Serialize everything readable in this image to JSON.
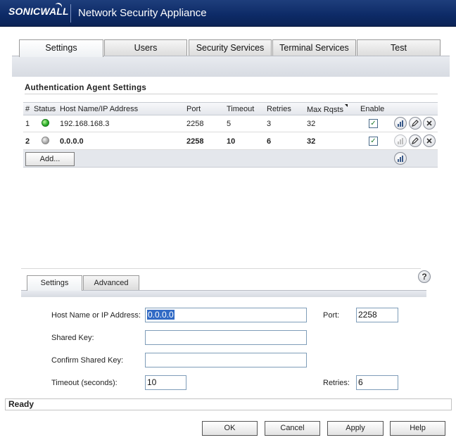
{
  "header": {
    "logo": "SONICWALL",
    "title": "Network Security Appliance"
  },
  "top_tabs": [
    {
      "label": "Settings",
      "active": true
    },
    {
      "label": "Users",
      "active": false
    },
    {
      "label": "Security Services",
      "active": false
    },
    {
      "label": "Terminal Services",
      "active": false
    },
    {
      "label": "Test",
      "active": false
    }
  ],
  "section": {
    "title": "Authentication Agent Settings"
  },
  "table": {
    "columns": [
      "#",
      "Status",
      "Host Name/IP Address",
      "Port",
      "Timeout",
      "Retries",
      "Max Rqsts",
      "Enable"
    ],
    "rows": [
      {
        "num": "1",
        "status": "green",
        "host": "192.168.168.3",
        "port": "2258",
        "timeout": "5",
        "retries": "3",
        "max": "32",
        "enable": "✓"
      },
      {
        "num": "2",
        "status": "grey",
        "host": "0.0.0.0",
        "port": "2258",
        "timeout": "10",
        "retries": "6",
        "max": "32",
        "enable": "✓"
      }
    ],
    "add_label": "Add..."
  },
  "sub_tabs": [
    {
      "label": "Settings",
      "active": true
    },
    {
      "label": "Advanced",
      "active": false
    }
  ],
  "form": {
    "host_label": "Host Name or IP Address:",
    "host_value": "0.0.0.0",
    "port_label": "Port:",
    "port_value": "2258",
    "shared_key_label": "Shared Key:",
    "shared_key_value": "",
    "confirm_key_label": "Confirm Shared Key:",
    "confirm_key_value": "",
    "timeout_label": "Timeout (seconds):",
    "timeout_value": "10",
    "retries_label": "Retries:",
    "retries_value": "6"
  },
  "help_glyph": "?",
  "status_bar": {
    "text": "Ready"
  },
  "buttons": {
    "ok": "OK",
    "cancel": "Cancel",
    "apply": "Apply",
    "help": "Help"
  },
  "colors": {
    "header_bg": "#0d2a66",
    "status_green": "#2fb22b",
    "status_grey": "#a9a9a9"
  }
}
